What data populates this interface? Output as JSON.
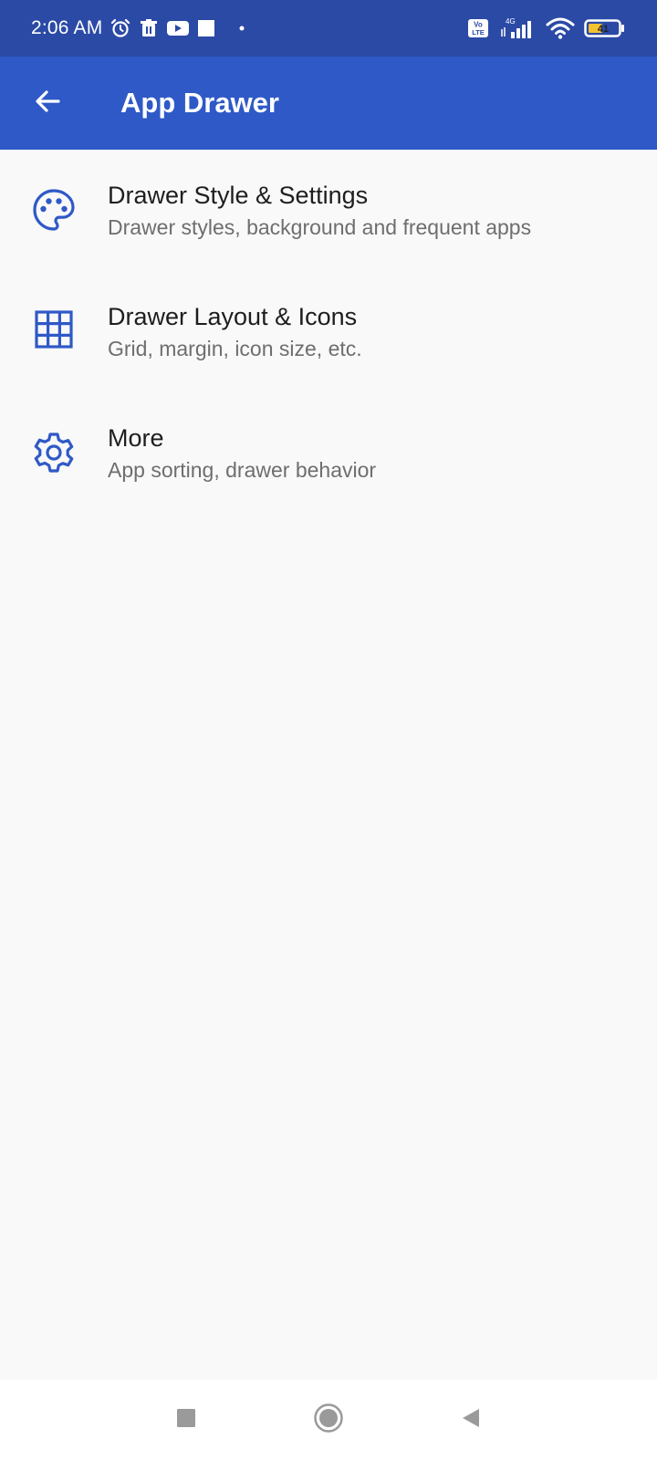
{
  "status_bar": {
    "time": "2:06 AM",
    "network_label": "4G",
    "volte_label": "Vo LTE",
    "battery_level": "41"
  },
  "app_bar": {
    "title": "App Drawer",
    "back_icon": "arrow-left-icon"
  },
  "menu": {
    "items": [
      {
        "title": "Drawer Style & Settings",
        "subtitle": "Drawer styles, background and frequent apps",
        "icon": "palette-icon"
      },
      {
        "title": "Drawer Layout & Icons",
        "subtitle": "Grid, margin, icon size, etc.",
        "icon": "grid-icon"
      },
      {
        "title": "More",
        "subtitle": "App sorting, drawer behavior",
        "icon": "gear-icon"
      }
    ]
  },
  "colors": {
    "status_bar": "#2b4aa6",
    "app_bar": "#2f59c7",
    "accent_icon": "#2f59c7",
    "background": "#f9f9f9"
  },
  "nav_bar": {
    "buttons": [
      "recents-icon",
      "home-icon",
      "back-icon"
    ]
  }
}
